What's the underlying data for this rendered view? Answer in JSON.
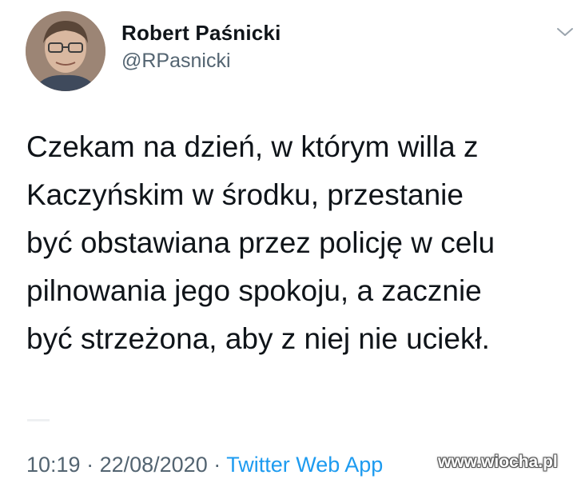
{
  "author": {
    "display_name": "Robert Paśnicki",
    "handle": "@RPasnicki",
    "avatar_icon": "profile-photo"
  },
  "menu": {
    "icon": "chevron-down-icon"
  },
  "tweet": {
    "lines": [
      "Czekam na dzień, w którym willa z",
      "Kaczyńskim w środku, przestanie",
      "być obstawiana przez policję w celu",
      "pilnowania jego spokoju, a zacznie",
      "być strzeżona, aby z niej nie uciekł."
    ]
  },
  "meta": {
    "time": "10:19",
    "separator": " · ",
    "date": "22/08/2020",
    "source": "Twitter Web App"
  },
  "watermark": {
    "text": "www.wiocha.pl"
  },
  "colors": {
    "text": "#0f1419",
    "secondary": "#536471",
    "link": "#1d9bf0"
  }
}
